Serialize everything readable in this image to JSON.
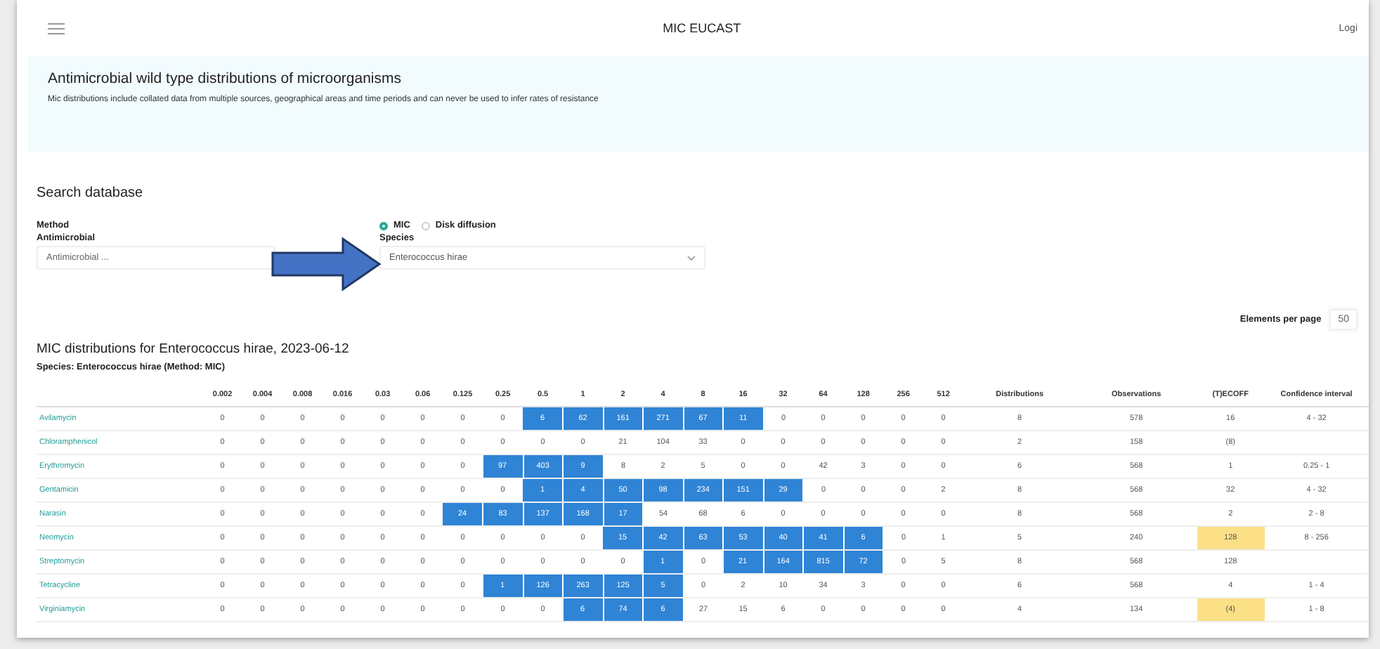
{
  "header": {
    "title": "MIC EUCAST",
    "login": "Logi"
  },
  "info": {
    "title": "Antimicrobial wild type distributions of microorganisms",
    "text": "Mic distributions include collated data from multiple sources, geographical areas and time periods and can never be used to infer rates of resistance"
  },
  "search": {
    "title": "Search database",
    "method_label": "Method",
    "methods": [
      {
        "label": "MIC",
        "selected": true
      },
      {
        "label": "Disk diffusion",
        "selected": false
      }
    ],
    "antimicrobial_label": "Antimicrobial",
    "antimicrobial_placeholder": "Antimicrobial ...",
    "species_label": "Species",
    "species_value": "Enterococcus hirae"
  },
  "paging": {
    "label": "Elements per page",
    "value": "50"
  },
  "results": {
    "title": "MIC distributions for Enterococcus hirae, 2023-06-12",
    "subtitle": "Species: Enterococcus hirae (Method: MIC)",
    "columns": [
      "0.002",
      "0.004",
      "0.008",
      "0.016",
      "0.03",
      "0.06",
      "0.125",
      "0.25",
      "0.5",
      "1",
      "2",
      "4",
      "8",
      "16",
      "32",
      "64",
      "128",
      "256",
      "512",
      "Distributions",
      "Observations",
      "(T)ECOFF",
      "Confidence interval"
    ],
    "rows": [
      {
        "name": "Avilamycin",
        "cells": [
          "0",
          "0",
          "0",
          "0",
          "0",
          "0",
          "0",
          "0",
          "6",
          "62",
          "161",
          "271",
          "67",
          "11",
          "0",
          "0",
          "0",
          "0",
          "0"
        ],
        "highlighted": [
          false,
          false,
          false,
          false,
          false,
          false,
          false,
          false,
          true,
          true,
          true,
          true,
          true,
          true,
          false,
          false,
          false,
          false,
          false
        ],
        "distributions": "8",
        "observations": "578",
        "ecoff": "16",
        "ecoff_highlighted": false,
        "ci": "4 - 32"
      },
      {
        "name": "Chloramphenicol",
        "cells": [
          "0",
          "0",
          "0",
          "0",
          "0",
          "0",
          "0",
          "0",
          "0",
          "0",
          "21",
          "104",
          "33",
          "0",
          "0",
          "0",
          "0",
          "0",
          "0"
        ],
        "highlighted": [
          false,
          false,
          false,
          false,
          false,
          false,
          false,
          false,
          false,
          false,
          false,
          false,
          false,
          false,
          false,
          false,
          false,
          false,
          false
        ],
        "distributions": "2",
        "observations": "158",
        "ecoff": "(8)",
        "ecoff_highlighted": false,
        "ci": ""
      },
      {
        "name": "Erythromycin",
        "cells": [
          "0",
          "0",
          "0",
          "0",
          "0",
          "0",
          "0",
          "97",
          "403",
          "9",
          "8",
          "2",
          "5",
          "0",
          "0",
          "42",
          "3",
          "0",
          "0"
        ],
        "highlighted": [
          false,
          false,
          false,
          false,
          false,
          false,
          false,
          true,
          true,
          true,
          false,
          false,
          false,
          false,
          false,
          false,
          false,
          false,
          false
        ],
        "distributions": "6",
        "observations": "568",
        "ecoff": "1",
        "ecoff_highlighted": false,
        "ci": "0.25 - 1"
      },
      {
        "name": "Gentamicin",
        "cells": [
          "0",
          "0",
          "0",
          "0",
          "0",
          "0",
          "0",
          "0",
          "1",
          "4",
          "50",
          "98",
          "234",
          "151",
          "29",
          "0",
          "0",
          "0",
          "2"
        ],
        "highlighted": [
          false,
          false,
          false,
          false,
          false,
          false,
          false,
          false,
          true,
          true,
          true,
          true,
          true,
          true,
          true,
          false,
          false,
          false,
          false
        ],
        "distributions": "8",
        "observations": "568",
        "ecoff": "32",
        "ecoff_highlighted": false,
        "ci": "4 - 32"
      },
      {
        "name": "Narasin",
        "cells": [
          "0",
          "0",
          "0",
          "0",
          "0",
          "0",
          "24",
          "83",
          "137",
          "168",
          "17",
          "54",
          "68",
          "6",
          "0",
          "0",
          "0",
          "0",
          "0"
        ],
        "highlighted": [
          false,
          false,
          false,
          false,
          false,
          false,
          true,
          true,
          true,
          true,
          true,
          false,
          false,
          false,
          false,
          false,
          false,
          false,
          false
        ],
        "distributions": "8",
        "observations": "568",
        "ecoff": "2",
        "ecoff_highlighted": false,
        "ci": "2 - 8"
      },
      {
        "name": "Neomycin",
        "cells": [
          "0",
          "0",
          "0",
          "0",
          "0",
          "0",
          "0",
          "0",
          "0",
          "0",
          "15",
          "42",
          "63",
          "53",
          "40",
          "41",
          "6",
          "0",
          "1"
        ],
        "highlighted": [
          false,
          false,
          false,
          false,
          false,
          false,
          false,
          false,
          false,
          false,
          true,
          true,
          true,
          true,
          true,
          true,
          true,
          false,
          false
        ],
        "distributions": "5",
        "observations": "240",
        "ecoff": "128",
        "ecoff_highlighted": true,
        "ci": "8 - 256"
      },
      {
        "name": "Streptomycin",
        "cells": [
          "0",
          "0",
          "0",
          "0",
          "0",
          "0",
          "0",
          "0",
          "0",
          "0",
          "0",
          "1",
          "0",
          "21",
          "164",
          "815",
          "72",
          "0",
          "5"
        ],
        "highlighted": [
          false,
          false,
          false,
          false,
          false,
          false,
          false,
          false,
          false,
          false,
          false,
          true,
          false,
          true,
          true,
          true,
          true,
          false,
          false
        ],
        "distributions": "8",
        "observations": "568",
        "ecoff": "128",
        "ecoff_highlighted": false,
        "ci": ""
      },
      {
        "name": "Tetracycline",
        "cells": [
          "0",
          "0",
          "0",
          "0",
          "0",
          "0",
          "0",
          "1",
          "126",
          "263",
          "125",
          "5",
          "0",
          "2",
          "10",
          "34",
          "3",
          "0",
          "0"
        ],
        "highlighted": [
          false,
          false,
          false,
          false,
          false,
          false,
          false,
          true,
          true,
          true,
          true,
          true,
          false,
          false,
          false,
          false,
          false,
          false,
          false
        ],
        "distributions": "6",
        "observations": "568",
        "ecoff": "4",
        "ecoff_highlighted": false,
        "ci": "1 - 4"
      },
      {
        "name": "Virginiamycin",
        "cells": [
          "0",
          "0",
          "0",
          "0",
          "0",
          "0",
          "0",
          "0",
          "0",
          "6",
          "74",
          "6",
          "27",
          "15",
          "6",
          "0",
          "0",
          "0",
          "0"
        ],
        "highlighted": [
          false,
          false,
          false,
          false,
          false,
          false,
          false,
          false,
          false,
          true,
          true,
          true,
          false,
          false,
          false,
          false,
          false,
          false,
          false
        ],
        "distributions": "4",
        "observations": "134",
        "ecoff": "(4)",
        "ecoff_highlighted": true,
        "ci": "1 - 8"
      }
    ]
  }
}
